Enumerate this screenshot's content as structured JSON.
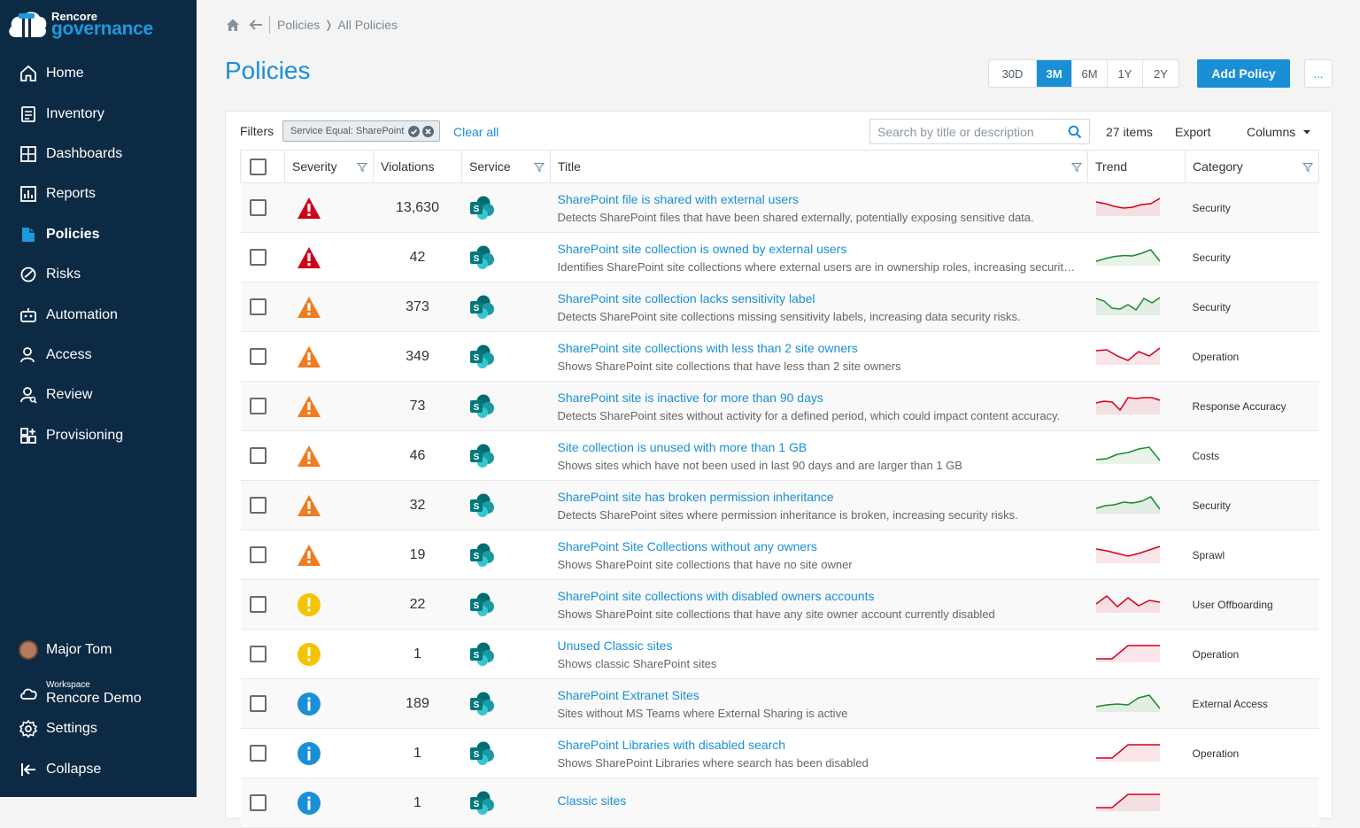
{
  "brand": {
    "line1": "Rencore",
    "line2": "governance"
  },
  "nav": [
    {
      "label": "Home",
      "icon": "home-icon"
    },
    {
      "label": "Inventory",
      "icon": "inventory-icon"
    },
    {
      "label": "Dashboards",
      "icon": "dashboards-icon"
    },
    {
      "label": "Reports",
      "icon": "reports-icon"
    },
    {
      "label": "Policies",
      "icon": "policies-icon",
      "active": true
    },
    {
      "label": "Risks",
      "icon": "risks-icon"
    },
    {
      "label": "Automation",
      "icon": "robot-icon"
    },
    {
      "label": "Access",
      "icon": "person-icon"
    },
    {
      "label": "Review",
      "icon": "review-icon"
    },
    {
      "label": "Provisioning",
      "icon": "provisioning-icon"
    }
  ],
  "user": {
    "name": "Major Tom"
  },
  "workspace": {
    "label": "Workspace",
    "name": "Rencore Demo"
  },
  "bottom_nav": {
    "settings": "Settings",
    "collapse": "Collapse"
  },
  "breadcrumb": {
    "first": "Policies",
    "separator": "❭",
    "second": "All Policies"
  },
  "page": {
    "title": "Policies"
  },
  "range_buttons": [
    "30D",
    "3M",
    "6M",
    "1Y",
    "2Y"
  ],
  "range_selected": "3M",
  "actions": {
    "add_policy": "Add Policy",
    "more": "..."
  },
  "filters": {
    "label": "Filters",
    "chip": "Service Equal: SharePoint",
    "clear_all": "Clear all"
  },
  "search": {
    "placeholder": "Search by title or description"
  },
  "toolbar": {
    "items_count": "27 items",
    "export": "Export",
    "columns": "Columns"
  },
  "columns": {
    "severity": "Severity",
    "violations": "Violations",
    "service": "Service",
    "title": "Title",
    "trend": "Trend",
    "category": "Category"
  },
  "colors": {
    "accent": "#1a8fd6",
    "sidebar": "#0d2a44",
    "critical": "#d0021b",
    "high": "#f07c1f",
    "medium": "#f5c400",
    "info": "#1a8fd6",
    "trend_up": "#1b8a2e",
    "trend_down": "#d0021b",
    "sharepoint": "#03787c"
  },
  "rows": [
    {
      "severity": "critical",
      "violations": "13,630",
      "title": "SharePoint file is shared with external users",
      "description": "Detects SharePoint files that have been shared externally, potentially exposing sensitive data.",
      "trend_color": "red",
      "trend": [
        0.7,
        0.6,
        0.45,
        0.35,
        0.4,
        0.55,
        0.6,
        0.9
      ],
      "category": "Security"
    },
    {
      "severity": "critical",
      "violations": "42",
      "title": "SharePoint site collection is owned by external users",
      "description": "Identifies SharePoint site collections where external users are in ownership roles, increasing security risks.",
      "trend_color": "green",
      "trend": [
        0.15,
        0.3,
        0.42,
        0.47,
        0.45,
        0.6,
        0.8,
        0.15
      ],
      "category": "Security"
    },
    {
      "severity": "high",
      "violations": "373",
      "title": "SharePoint site collection lacks sensitivity label",
      "description": "Detects SharePoint site collections missing sensitivity labels, increasing data security risks.",
      "trend_color": "green",
      "trend": [
        0.85,
        0.7,
        0.3,
        0.25,
        0.5,
        0.2,
        0.85,
        0.6,
        0.9
      ],
      "category": "Security"
    },
    {
      "severity": "high",
      "violations": "349",
      "title": "SharePoint site collections with less than 2 site owners",
      "description": "Shows SharePoint site collections that have less than 2 site owners",
      "trend_color": "red",
      "trend": [
        0.7,
        0.75,
        0.4,
        0.15,
        0.65,
        0.4,
        0.85
      ],
      "category": "Operation"
    },
    {
      "severity": "high",
      "violations": "73",
      "title": "SharePoint site is inactive for more than 90 days",
      "description": "Detects SharePoint sites without activity for a defined period, which could impact content accuracy.",
      "trend_color": "red",
      "trend": [
        0.55,
        0.65,
        0.6,
        0.15,
        0.85,
        0.8,
        0.85,
        0.85,
        0.7
      ],
      "category": "Response Accuracy"
    },
    {
      "severity": "high",
      "violations": "46",
      "title": "Site collection is unused with more than 1 GB",
      "description": "Shows sites which have not been used in last 90 days and are larger than 1 GB",
      "trend_color": "green",
      "trend": [
        0.15,
        0.2,
        0.45,
        0.55,
        0.75,
        0.85,
        0.1
      ],
      "category": "Costs"
    },
    {
      "severity": "high",
      "violations": "32",
      "title": "SharePoint site has broken permission inheritance",
      "description": "Detects SharePoint sites where permission inheritance is broken, increasing security risks.",
      "trend_color": "green",
      "trend": [
        0.2,
        0.35,
        0.4,
        0.55,
        0.5,
        0.6,
        0.85,
        0.15
      ],
      "category": "Security"
    },
    {
      "severity": "high",
      "violations": "19",
      "title": "SharePoint Site Collections without any owners",
      "description": "Shows SharePoint site collections that have no site owner",
      "trend_color": "red",
      "trend": [
        0.7,
        0.6,
        0.45,
        0.3,
        0.45,
        0.65,
        0.85
      ],
      "category": "Sprawl"
    },
    {
      "severity": "medium",
      "violations": "22",
      "title": "SharePoint site collections with disabled owners accounts",
      "description": "Shows SharePoint site collections that have any site owner account currently disabled",
      "trend_color": "red",
      "trend": [
        0.4,
        0.85,
        0.25,
        0.75,
        0.3,
        0.6,
        0.5
      ],
      "category": "User Offboarding"
    },
    {
      "severity": "medium",
      "violations": "1",
      "title": "Unused Classic sites",
      "description": "Shows classic SharePoint sites",
      "trend_color": "red",
      "trend": [
        0.1,
        0.1,
        0.85,
        0.85,
        0.85
      ],
      "category": "Operation"
    },
    {
      "severity": "info",
      "violations": "189",
      "title": "SharePoint Extranet Sites",
      "description": "Sites without MS Teams where External Sharing is active",
      "trend_color": "green",
      "trend": [
        0.2,
        0.3,
        0.35,
        0.3,
        0.7,
        0.85,
        0.1
      ],
      "category": "External Access"
    },
    {
      "severity": "info",
      "violations": "1",
      "title": "SharePoint Libraries with disabled search",
      "description": "Shows SharePoint Libraries where search has been disabled",
      "trend_color": "red",
      "trend": [
        0.1,
        0.1,
        0.85,
        0.85,
        0.85
      ],
      "category": "Operation"
    },
    {
      "severity": "info",
      "violations": "1",
      "title": "Classic sites",
      "description": "",
      "trend_color": "red",
      "trend": [
        0.1,
        0.1,
        0.85,
        0.85,
        0.85
      ],
      "category": ""
    }
  ]
}
